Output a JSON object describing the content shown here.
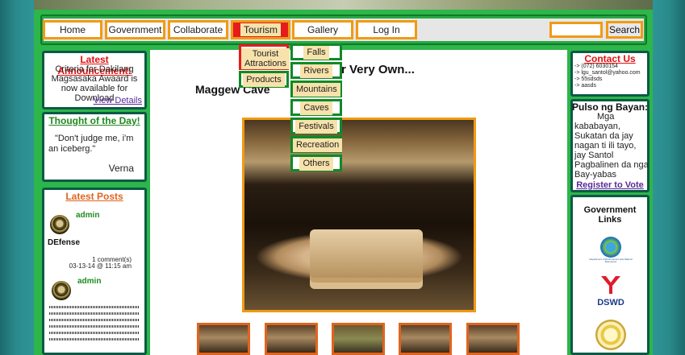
{
  "nav": {
    "items": [
      "Home",
      "Government",
      "Collaborate",
      "Tourism",
      "Gallery",
      "Log In"
    ],
    "active": "Tourism",
    "search_button": "Search"
  },
  "dropdown": {
    "tourism": [
      "Tourist Attractions",
      "Products"
    ],
    "attractions": [
      "Falls",
      "Rivers",
      "Mountains",
      "Caves",
      "Festivals",
      "Recreation",
      "Others"
    ]
  },
  "left": {
    "announcement": {
      "title": "Latest Announcement!",
      "body": "Criteria for Dakilang Magsasaka Awaard is now available for Download",
      "link": "View Details"
    },
    "thought": {
      "title": "Thought of the Day!",
      "quote": "\"Don't judge me, i'm an iceberg.\"",
      "author": "Verna"
    },
    "posts": {
      "title": "Latest Posts",
      "items": [
        {
          "author": "admin",
          "title": "DEfense",
          "comments": "1 comment(s)",
          "date": "03-13-14 @ 11:15 am"
        },
        {
          "author": "admin"
        }
      ]
    }
  },
  "main": {
    "heading_fragment": "r Very Own...",
    "subheading": "Maggew Cave"
  },
  "right": {
    "contact": {
      "title": "Contact Us",
      "lines": [
        "-> (072) 6030154",
        "-> lgu_santol@yahoo.com",
        "-> 55sdsds",
        "-> aasds"
      ]
    },
    "pulso": {
      "title": "Pulso ng Bayan:",
      "body": "Mga kababayan, Sukatan da jay nagan ti ili tayo, jay Santol Pagbalinen da nga Bay-yabas",
      "link": "Register to Vote"
    },
    "gov_links": {
      "title": "Government Links",
      "logos": [
        "Department of Environment and Natural Resources",
        "DSWD"
      ]
    }
  },
  "colors": {
    "frame": "#2db64a",
    "nav_border": "#f19a14",
    "active_tab": "#e51c1c",
    "panel_border": "#0b5a45"
  }
}
